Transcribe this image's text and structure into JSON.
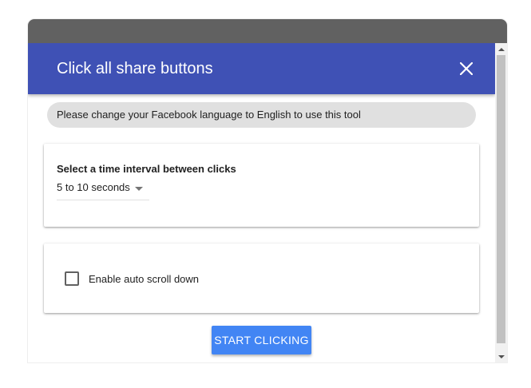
{
  "dialog": {
    "title": "Click all share buttons",
    "close_icon": "close-icon"
  },
  "notice": {
    "text": "Please change your Facebook language to English to use this tool"
  },
  "interval": {
    "label": "Select a time interval between clicks",
    "selected": "5 to 10 seconds"
  },
  "auto_scroll": {
    "label": "Enable auto scroll down",
    "checked": false
  },
  "actions": {
    "start_label": "START CLICKING"
  },
  "colors": {
    "header": "#3f51b5",
    "button": "#4285f4",
    "titlebar": "#616161",
    "notice_bg": "#e0e0e0"
  }
}
